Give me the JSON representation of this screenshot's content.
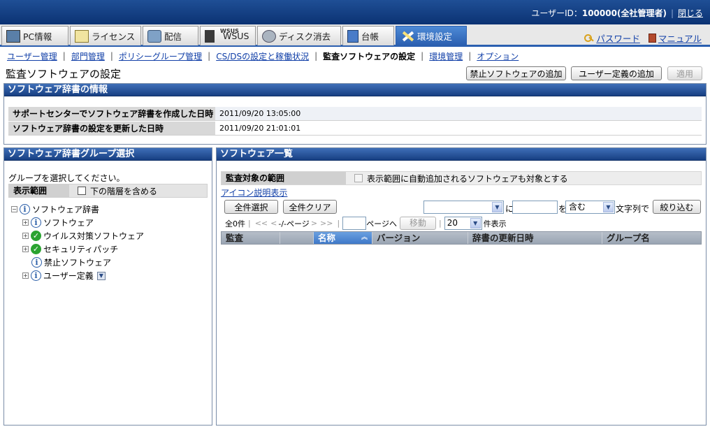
{
  "header": {
    "user_label": "ユーザーID：",
    "user_id": "100000(全社管理者)",
    "close_label": "閉じる"
  },
  "tabs": [
    {
      "label": "PC情報",
      "icon": "pc-icon"
    },
    {
      "label": "ライセンス",
      "icon": "license-icon"
    },
    {
      "label": "配信",
      "icon": "distribution-icon"
    },
    {
      "label": "WSUS",
      "icon": "wsus-icon",
      "tag": "WSUS"
    },
    {
      "label": "ディスク消去",
      "icon": "disk-erase-icon"
    },
    {
      "label": "台帳",
      "icon": "ledger-icon"
    },
    {
      "label": "環境設定",
      "icon": "settings-tools-icon",
      "active": true
    }
  ],
  "top_links": {
    "password": "パスワード",
    "manual": "マニュアル"
  },
  "subnav": [
    {
      "label": "ユーザー管理"
    },
    {
      "label": "部門管理"
    },
    {
      "label": "ポリシーグループ管理"
    },
    {
      "label": "CS/DSの設定と稼働状況"
    },
    {
      "label": "監査ソフトウェアの設定",
      "current": true
    },
    {
      "label": "環境管理"
    },
    {
      "label": "オプション"
    }
  ],
  "page": {
    "title": "監査ソフトウェアの設定",
    "btn_add_prohibited": "禁止ソフトウェアの追加",
    "btn_add_user_def": "ユーザー定義の追加",
    "btn_apply": "適用"
  },
  "dict_info": {
    "title": "ソフトウェア辞書の情報",
    "rows": [
      {
        "key": "サポートセンターでソフトウェア辞書を作成した日時",
        "value": "2011/09/20 13:05:00"
      },
      {
        "key": "ソフトウェア辞書の設定を更新した日時",
        "value": "2011/09/20 21:01:01"
      }
    ]
  },
  "group_panel": {
    "title": "ソフトウェア辞書グループ選択",
    "hint": "グループを選択してください。",
    "range_label": "表示範囲",
    "include_sub_label": "下の階層を含める",
    "tree": [
      {
        "label": "ソフトウェア辞書",
        "toggle": "−",
        "icon": "info"
      },
      {
        "label": "ソフトウェア",
        "toggle": "+",
        "icon": "info"
      },
      {
        "label": "ウイルス対策ソフトウェア",
        "toggle": "+",
        "icon": "check"
      },
      {
        "label": "セキュリティパッチ",
        "toggle": "+",
        "icon": "check"
      },
      {
        "label": "禁止ソフトウェア",
        "toggle": "",
        "icon": "info"
      },
      {
        "label": "ユーザー定義",
        "toggle": "+",
        "icon": "info",
        "dropdown": true
      }
    ]
  },
  "list_panel": {
    "title": "ソフトウェア一覧",
    "scope_label": "監査対象の範囲",
    "scope_option": "表示範囲に自動追加されるソフトウェアも対象とする",
    "icon_help_link": "アイコン説明表示",
    "btn_select_all": "全件選択",
    "btn_clear_all": "全件クリア",
    "filter": {
      "field_value": "",
      "ni_label": "に",
      "text_value": "",
      "wo_label": "を",
      "match_value": "含む",
      "suffix": "文字列で",
      "btn": "絞り込む"
    },
    "pager": {
      "count": "全0件",
      "pages": "-/-ページ",
      "goto_label": "ページへ",
      "move_btn": "移動",
      "page_size": "20",
      "page_size_suffix": "件表示"
    },
    "columns": [
      "監査",
      "",
      "名称",
      "バージョン",
      "辞書の更新日時",
      "グループ名"
    ],
    "sorted_column": "名称",
    "rows": []
  }
}
